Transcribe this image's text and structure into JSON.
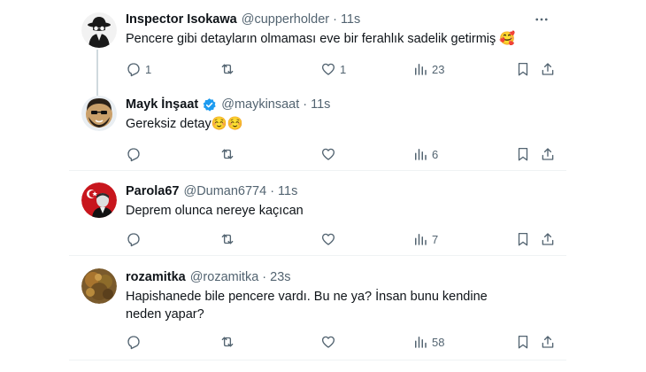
{
  "tweets": [
    {
      "name": "Inspector Isokawa",
      "handle": "@cupperholder",
      "separator": "·",
      "time": "11s",
      "text": "Pencere gibi detayların olmaması eve bir ferahlık sadelik getirmiş 🥰",
      "avatar_icon": "spy-avatar-icon",
      "verified": false,
      "replies": "1",
      "retweets": "",
      "likes": "1",
      "views": "23"
    },
    {
      "name": "Mayk İnşaat",
      "handle": "@maykinsaat",
      "separator": "·",
      "time": "11s",
      "text": "Gereksiz detay☺️☺️",
      "avatar_icon": "bearded-man-avatar-icon",
      "verified": true,
      "replies": "",
      "retweets": "",
      "likes": "",
      "views": "6"
    },
    {
      "name": "Parola67",
      "handle": "@Duman6774",
      "separator": "·",
      "time": "11s",
      "text": "Deprem olunca nereye kaçıcan",
      "avatar_icon": "flag-portrait-avatar-icon",
      "verified": false,
      "replies": "",
      "retweets": "",
      "likes": "",
      "views": "7"
    },
    {
      "name": "rozamitka",
      "handle": "@rozamitka",
      "separator": "·",
      "time": "23s",
      "text": "Hapishanede bile pencere vardı. Bu ne ya? İnsan bunu kendine neden yapar?",
      "avatar_icon": "autumn-photo-avatar-icon",
      "verified": false,
      "replies": "",
      "retweets": "",
      "likes": "",
      "views": "58"
    }
  ],
  "colors": {
    "text": "#0f1419",
    "secondary": "#536471",
    "divider": "#eff3f4",
    "verified": "#1d9bf0"
  }
}
